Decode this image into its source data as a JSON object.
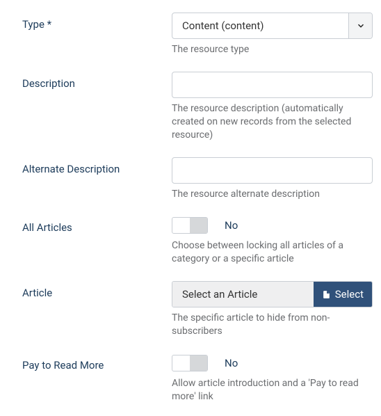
{
  "fields": {
    "type": {
      "label": "Type *",
      "value": "Content (content)",
      "help": "The resource type"
    },
    "description": {
      "label": "Description",
      "value": "",
      "help": "The resource description (automatically created on new records from the selected resource)"
    },
    "altDescription": {
      "label": "Alternate Description",
      "value": "",
      "help": "The resource alternate description"
    },
    "allArticles": {
      "label": "All Articles",
      "stateText": "No",
      "help": "Choose between locking all articles of a category or a specific article"
    },
    "article": {
      "label": "Article",
      "placeholder": "Select an Article",
      "button": "Select",
      "help": "The specific article to hide from non-subscribers"
    },
    "payToReadMore": {
      "label": "Pay to Read More",
      "stateText": "No",
      "help": "Allow article introduction and a 'Pay to read more' link"
    }
  }
}
